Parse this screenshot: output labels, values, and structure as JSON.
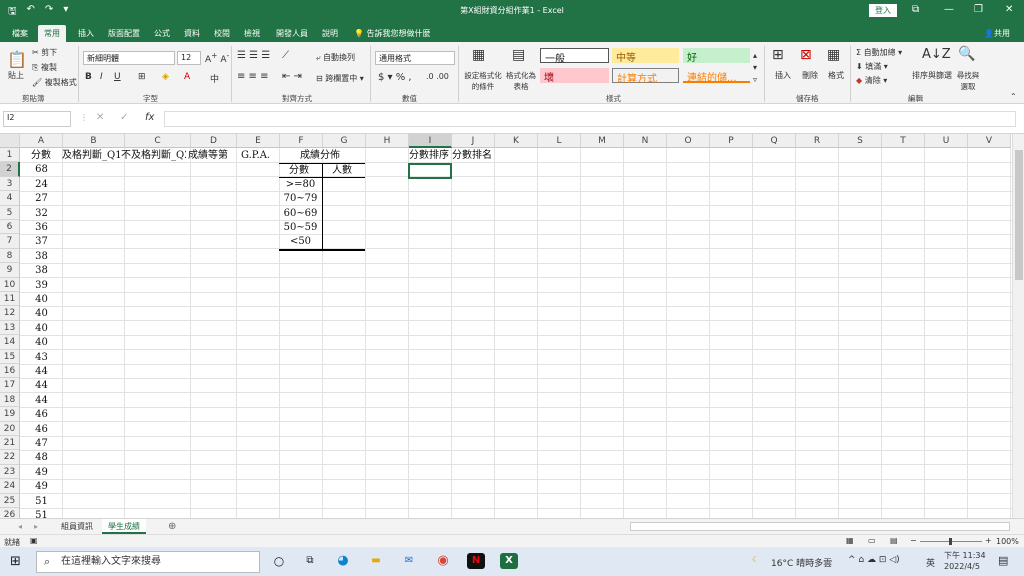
{
  "window": {
    "title": "第X組財資分組作業1 - Excel",
    "login_label": "登入"
  },
  "ribbon_tabs": [
    "檔案",
    "常用",
    "插入",
    "版面配置",
    "公式",
    "資料",
    "校閱",
    "檢視",
    "開發人員",
    "說明"
  ],
  "tell_me": "告訴我您想做什麼",
  "share": "共用",
  "ribbon": {
    "clipboard": {
      "paste": "貼上",
      "cut": "剪下",
      "copy": "複製",
      "format_painter": "複製格式",
      "label": "剪貼簿"
    },
    "font": {
      "name": "新細明體",
      "size": "12",
      "label": "字型"
    },
    "alignment": {
      "wrap": "自動換列",
      "merge": "跨欄置中",
      "label": "對齊方式"
    },
    "number": {
      "format": "通用格式",
      "label": "數值"
    },
    "styles": {
      "conditional": "設定格式化的條件",
      "table": "格式化為表格",
      "normal": "一般",
      "neutral": "中等",
      "good": "好",
      "bad": "壞",
      "calc": "計算方式",
      "linked": "連結的儲...",
      "label": "樣式"
    },
    "cells": {
      "insert": "插入",
      "delete": "刪除",
      "format": "格式",
      "label": "儲存格"
    },
    "editing": {
      "autosum": "自動加總",
      "fill": "填滿",
      "clear": "清除",
      "sort": "排序與篩選",
      "find": "尋找與選取",
      "label": "編輯"
    }
  },
  "formula_bar": {
    "name_box": "I2",
    "formula": ""
  },
  "columns": [
    "A",
    "B",
    "C",
    "D",
    "E",
    "F",
    "G",
    "H",
    "I",
    "J",
    "K",
    "L",
    "M",
    "N",
    "O",
    "P",
    "Q",
    "R",
    "S",
    "T",
    "U",
    "V"
  ],
  "rows": [
    "1",
    "2",
    "3",
    "4",
    "5",
    "6",
    "7",
    "8",
    "9",
    "10",
    "11",
    "12",
    "13",
    "14",
    "15",
    "16",
    "17",
    "18",
    "19",
    "20",
    "21",
    "22",
    "23",
    "24",
    "25",
    "26"
  ],
  "sheet": {
    "A_header": "分數",
    "B_header": "及格判斷_Q1",
    "C_header": "不及格判斷_Q2",
    "D_header": "成績等第",
    "E_header": "G.P.A.",
    "dist_title": "成績分佈",
    "dist_col1": "分數",
    "dist_col2": "人數",
    "bins": [
      ">=80",
      "70~79",
      "60~69",
      "50~59",
      "<50"
    ],
    "I_header": "分數排序",
    "J_header": "分數排名",
    "scores": [
      "68",
      "24",
      "27",
      "32",
      "36",
      "37",
      "38",
      "38",
      "39",
      "40",
      "40",
      "40",
      "40",
      "43",
      "44",
      "44",
      "44",
      "46",
      "46",
      "47",
      "48",
      "49",
      "49",
      "51",
      "51"
    ]
  },
  "sheet_tabs": [
    "組員資訊",
    "學生成績"
  ],
  "status": {
    "ready": "就緒",
    "zoom": "100%"
  },
  "taskbar": {
    "search_placeholder": "在這裡輸入文字來搜尋",
    "weather": "16°C 晴時多雲",
    "ime": "英",
    "time": "下午 11:34",
    "date": "2022/4/5"
  }
}
